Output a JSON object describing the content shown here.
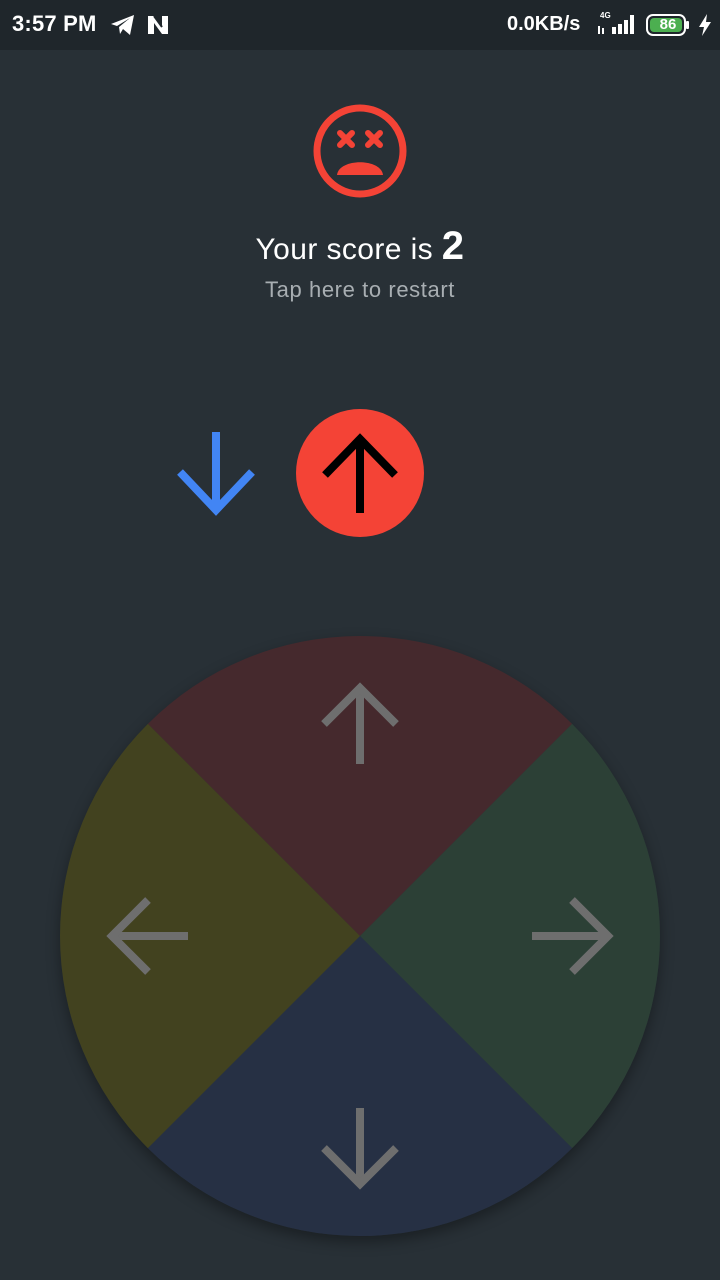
{
  "status_bar": {
    "time": "3:57 PM",
    "network_speed": "0.0KB/s",
    "network_type": "4G",
    "battery_level": "86",
    "icons": [
      "telegram-icon",
      "n-notification-icon",
      "signal-icon",
      "battery-icon",
      "charging-icon"
    ]
  },
  "game_over": {
    "face_icon": "dizzy-face-icon",
    "score_prefix": "Your score is",
    "score": "2",
    "restart_text": "Tap here to restart"
  },
  "sequence": {
    "next_direction": "down",
    "current_direction": "up"
  },
  "dpad": {
    "segments": [
      {
        "direction": "up",
        "icon": "arrow-up-icon"
      },
      {
        "direction": "right",
        "icon": "arrow-right-icon"
      },
      {
        "direction": "down",
        "icon": "arrow-down-icon"
      },
      {
        "direction": "left",
        "icon": "arrow-left-icon"
      }
    ]
  },
  "colors": {
    "background": "#283036",
    "status_bar": "#1f262b",
    "accent_red": "#f44336",
    "next_arrow_blue": "#4285f4",
    "dpad_up": "#45292d",
    "dpad_right": "#2c4036",
    "dpad_down": "#263044",
    "dpad_left": "#42421f",
    "dpad_arrow": "#6e6e6e"
  }
}
